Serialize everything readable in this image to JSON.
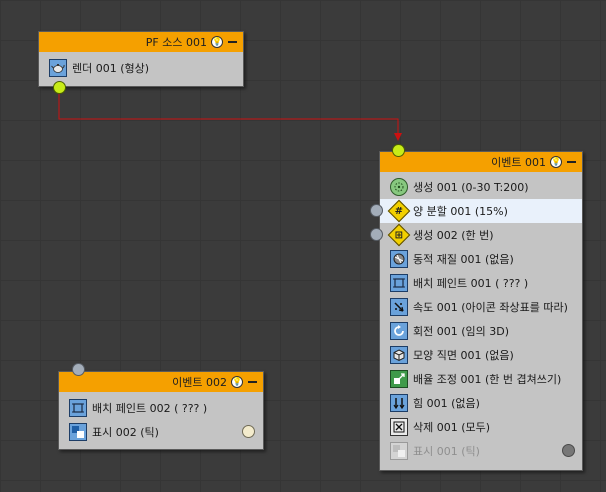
{
  "source_node": {
    "title": "PF 소스 001",
    "operators": [
      {
        "label": "렌더 001 (형상)",
        "icon": "teapot-icon"
      }
    ]
  },
  "event1_node": {
    "title": "이벤트 001",
    "operators": [
      {
        "label": "생성 001 (0-30 T:200)",
        "icon": "birth-icon"
      },
      {
        "label": "양 분할 001 (15%)",
        "icon": "split-amount-icon"
      },
      {
        "label": "생성 002 (한 번)",
        "icon": "spawn-icon"
      },
      {
        "label": "동적 재질 001 (없음)",
        "icon": "material-dynamic-icon"
      },
      {
        "label": "배치 페인트 001 ( ??? )",
        "icon": "position-paint-icon"
      },
      {
        "label": "속도 001 (아이콘 좌상표를 따라)",
        "icon": "speed-icon"
      },
      {
        "label": "회전 001 (임의 3D)",
        "icon": "rotation-icon"
      },
      {
        "label": "모양 직면 001 (없음)",
        "icon": "shape-facing-icon"
      },
      {
        "label": "배율 조정 001 (한 번 겹쳐쓰기)",
        "icon": "scale-icon"
      },
      {
        "label": "힘 001 (없음)",
        "icon": "force-icon"
      },
      {
        "label": "삭제 001 (모두)",
        "icon": "delete-icon"
      },
      {
        "label": "표시 001 (틱)",
        "icon": "display-icon"
      }
    ]
  },
  "event2_node": {
    "title": "이벤트 002",
    "operators": [
      {
        "label": "배치 페인트 002 ( ??? )",
        "icon": "position-paint-icon"
      },
      {
        "label": "표시 002 (틱)",
        "icon": "display-icon"
      }
    ]
  },
  "colors": {
    "header": "#f5a000",
    "node_body": "#c4c4c4",
    "wire": "#cc1010",
    "socket_green": "#c8ec18",
    "selected_row": "#e9f1fb"
  }
}
